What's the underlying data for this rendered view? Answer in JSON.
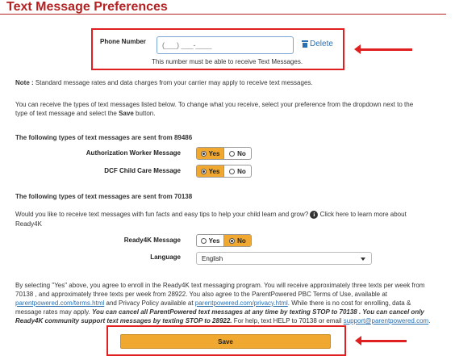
{
  "page": {
    "title": "Text Message Preferences"
  },
  "phone": {
    "label": "Phone Number",
    "placeholder": "(___) ___-____",
    "delete_label": "Delete",
    "help": "This number must be able to receive Text Messages."
  },
  "note": {
    "label": "Note :",
    "text": " Standard message rates and data charges from your carrier may apply to receive text messages."
  },
  "intro": {
    "line1": "You can receive the types of text messages listed below. To change what you receive, select your preference from the dropdown next to the",
    "line2_prefix": "type of text message and select the ",
    "line2_bold": "Save",
    "line2_suffix": " button."
  },
  "section1": {
    "heading": "The following types of text messages are sent from 89486",
    "rows": [
      {
        "label": "Authorization Worker Message",
        "yes": "Yes",
        "no": "No",
        "selected": "yes"
      },
      {
        "label": "DCF Child Care Message",
        "yes": "Yes",
        "no": "No",
        "selected": "yes"
      }
    ]
  },
  "section2": {
    "heading": "The following types of text messages are sent from 70138",
    "question": "Would you like to receive text messages with fun facts and easy tips to help your child learn and grow?",
    "info_icon": "info-icon",
    "learn_more": "Click here to learn more about",
    "learn_more_2": "Ready4K",
    "ready4k": {
      "label": "Ready4K Message",
      "yes": "Yes",
      "no": "No",
      "selected": "no"
    },
    "language": {
      "label": "Language",
      "value": "English"
    }
  },
  "terms": {
    "l1": "By selecting \"Yes\" above, you agree to enroll in the Ready4K text messaging program. You will receive approximately three texts per week from",
    "l2": "70138 , and approximately three texts per week from 28922. You also agree to the ParentPowered PBC Terms of Use, available at",
    "l3_link": "parentpowered.com/terms.html",
    "l3_mid": " and Privacy Policy available at ",
    "l3_link2": "parentpowered.com/privacy.html",
    "l3_suffix": ". While there is no cost for enrolling, data &",
    "l4_prefix": "message rates may apply. ",
    "l4_bold": "You can cancel all ParentPowered text messages at any time by texting STOP to 70138 . You can cancel only",
    "l5_bold": "Ready4K community support text messages by texting STOP to 28922.",
    "l5_suffix": " For help, text HELP to 70138 or email ",
    "l5_link": "support@parentpowered.com",
    "l5_end": "."
  },
  "save": {
    "label": "Save"
  },
  "colors": {
    "title": "#b22222",
    "accent": "#f0a830",
    "highlight": "#e02020",
    "link": "#2a6fb0"
  }
}
